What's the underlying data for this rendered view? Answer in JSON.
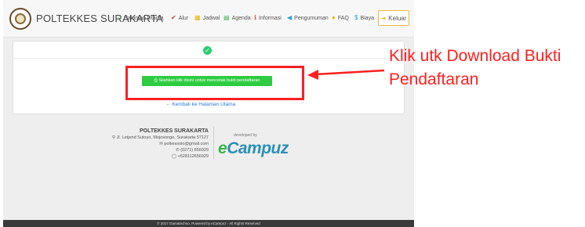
{
  "navbar": {
    "brand": "POLTEKKES SURAKARTA",
    "items": [
      {
        "label": "Halaman Utama",
        "icon": "home-icon"
      },
      {
        "label": "Alur",
        "icon": "check-icon"
      },
      {
        "label": "Jadwal",
        "icon": "calendar-icon"
      },
      {
        "label": "Agenda",
        "icon": "agenda-icon"
      },
      {
        "label": "Informasi",
        "icon": "info-icon"
      },
      {
        "label": "Pengumuman",
        "icon": "megaphone-icon"
      },
      {
        "label": "FAQ",
        "icon": "faq-icon"
      },
      {
        "label": "Biaya",
        "icon": "dollar-icon"
      }
    ],
    "logout": "Keluar"
  },
  "main": {
    "download_button": "Silahkan klik disini untuk mencetak bukti pendaftaran",
    "back_link": "Kembali ke Halaman Utama"
  },
  "footer": {
    "title": "POLTEKKES SURAKARTA",
    "address": "Jl. Letjend Sutoyo, Mojosongo, Surakarta 57127",
    "email": "polkessolo@gmail.com",
    "phone": "(0271) 856929",
    "whatsapp": "+628112656929",
    "developed_by": "developed by",
    "dev_brand_e": "e",
    "dev_brand_rest": "Campuz",
    "copyright": "© 2017 Gamatechno. Powered by eCampuz - All Rights Reserved"
  },
  "annotation": {
    "line1": "Klik utk Download Bukti",
    "line2": "Pendaftaran"
  },
  "colors": {
    "accent_green": "#2ecc40",
    "link_blue": "#2a7bd8",
    "annotation_red": "#ff1f1f"
  }
}
